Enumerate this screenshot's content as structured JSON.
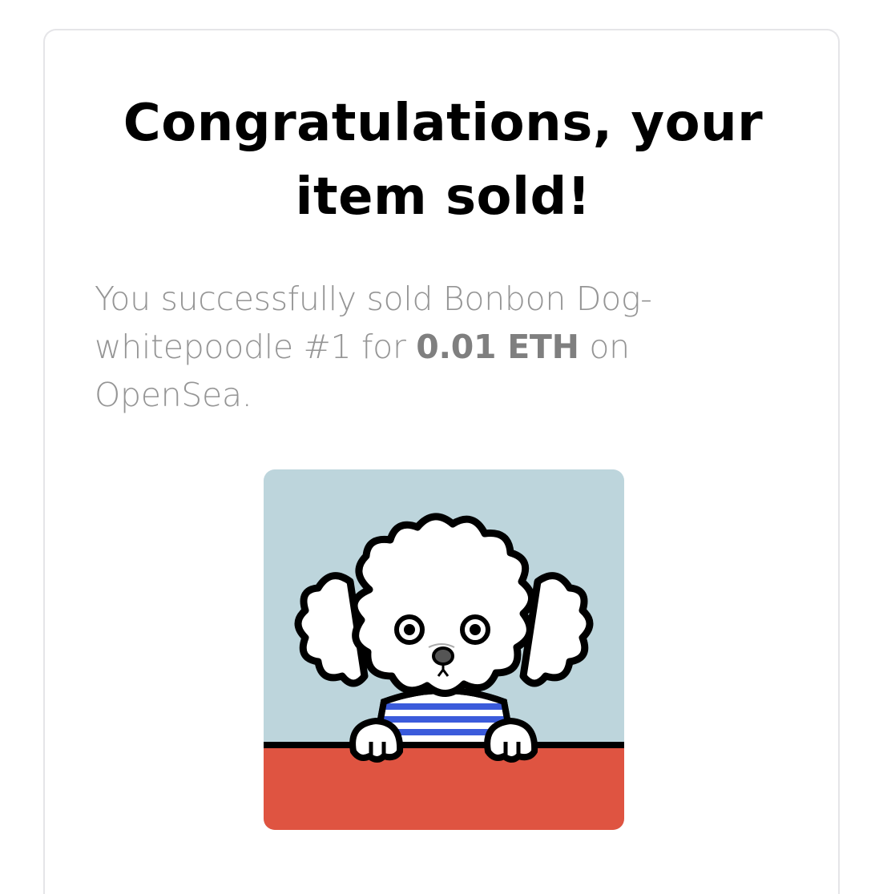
{
  "notification": {
    "title_line1": "Congratulations, your",
    "title_line2": "item sold!",
    "message_line1": "You successfully sold Bonbon Dog-",
    "message_line2_prefix": "whitepoodle #1 for ",
    "price": "0.01 ETH",
    "message_line2_suffix": " on",
    "message_line3": "OpenSea."
  },
  "nft_image": {
    "subject": "white-poodle-icon",
    "colors": {
      "background": "#bdd5dc",
      "table": "#df5441",
      "stripes": "#3b5bdb",
      "outline": "#000000",
      "fur": "#ffffff"
    }
  },
  "colors": {
    "title": "#000000",
    "message": "#959595",
    "price": "#7f7f7f",
    "card_border": "#e5e5e8"
  }
}
